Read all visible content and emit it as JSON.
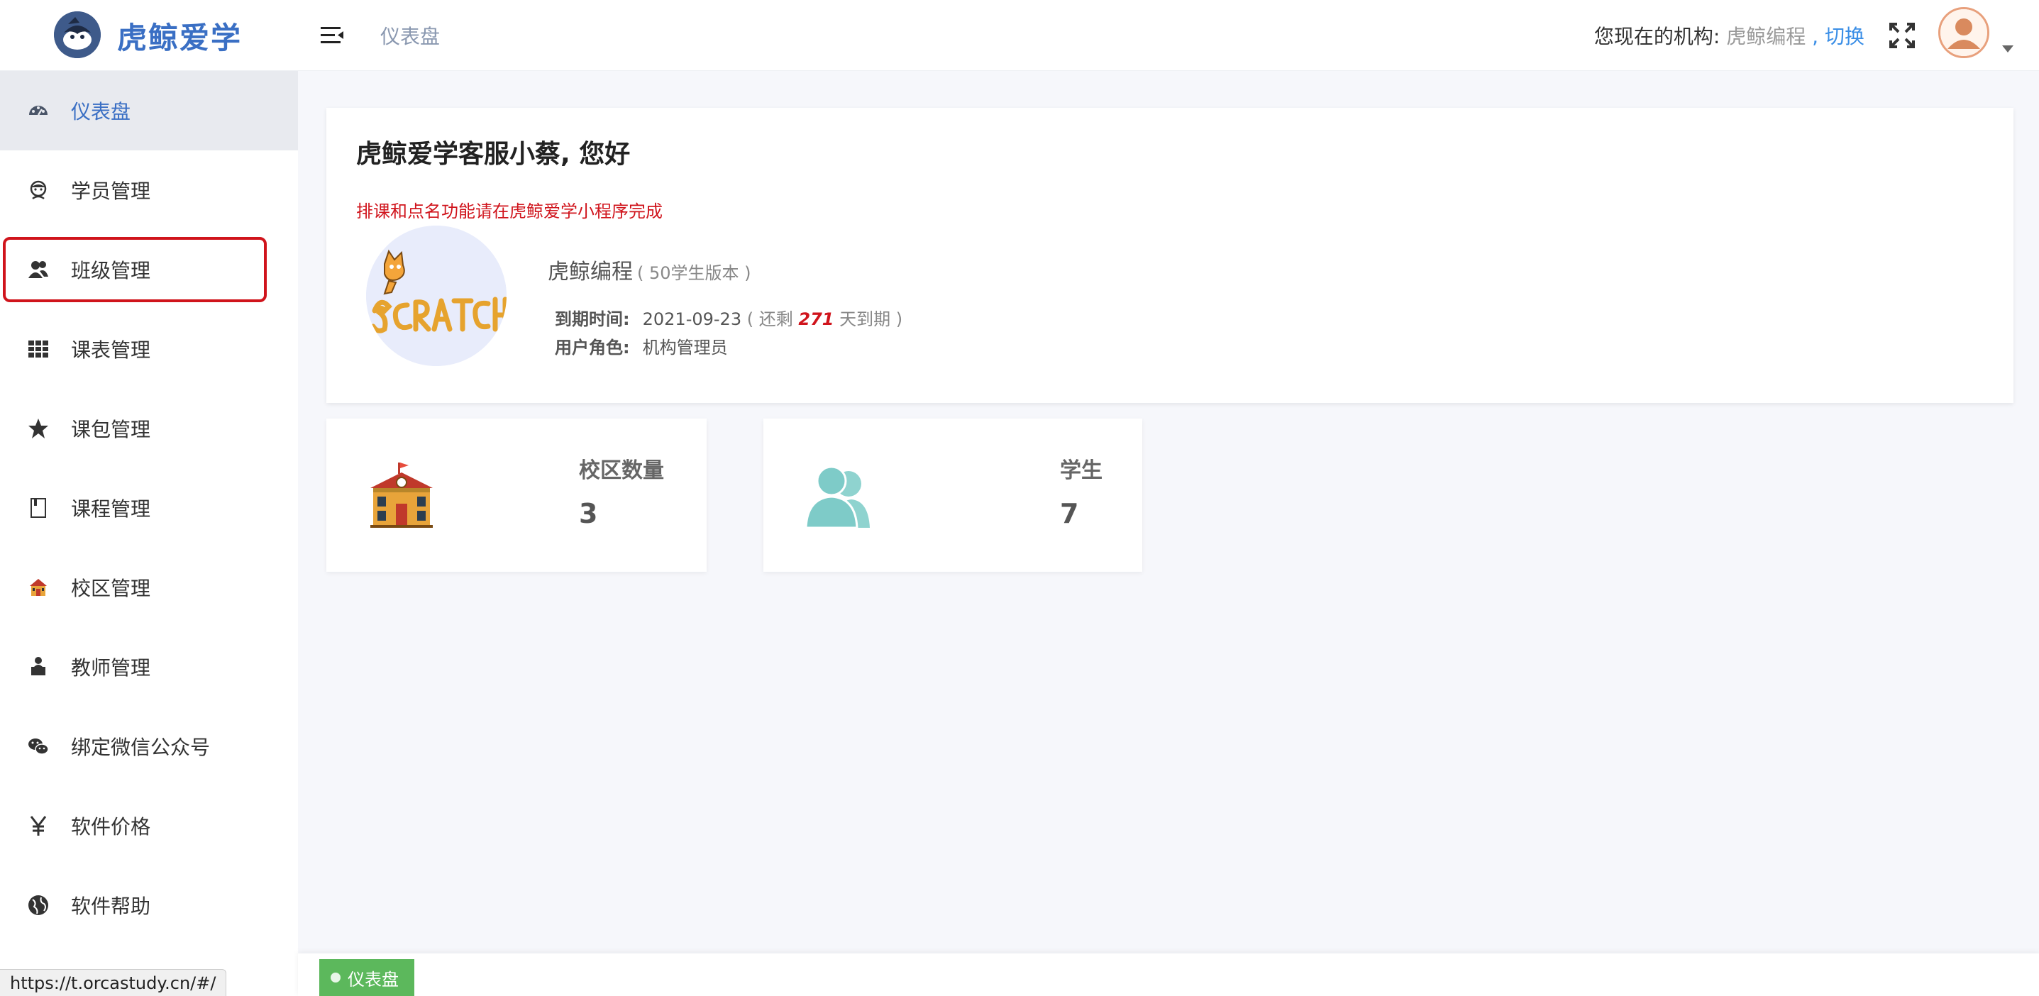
{
  "header": {
    "brand": "虎鲸爱学",
    "breadcrumb": "仪表盘",
    "org_label": "您现在的机构: ",
    "org_name": "虎鲸编程",
    "org_separator": " , ",
    "org_switch": "切换"
  },
  "sidebar": {
    "items": [
      {
        "label": "仪表盘",
        "icon": "dashboard-icon"
      },
      {
        "label": "学员管理",
        "icon": "student-icon"
      },
      {
        "label": "班级管理",
        "icon": "users-icon"
      },
      {
        "label": "课表管理",
        "icon": "grid-icon"
      },
      {
        "label": "课包管理",
        "icon": "star-icon"
      },
      {
        "label": "课程管理",
        "icon": "book-icon"
      },
      {
        "label": "校区管理",
        "icon": "school-icon"
      },
      {
        "label": "教师管理",
        "icon": "teacher-icon"
      },
      {
        "label": "绑定微信公众号",
        "icon": "wechat-icon"
      },
      {
        "label": "软件价格",
        "icon": "yen-icon"
      },
      {
        "label": "软件帮助",
        "icon": "globe-icon"
      }
    ]
  },
  "welcome": {
    "title": "虎鲸爱学客服小蔡, 您好",
    "notice": "排课和点名功能请在虎鲸爱学小程序完成",
    "org_name": "虎鲸编程",
    "version": "( 50学生版本 )",
    "expire_label": "到期时间:",
    "expire_date": "2021-09-23",
    "expire_prefix": "( 还剩",
    "expire_days": "271",
    "expire_suffix": "天到期 )",
    "role_label": "用户角色:",
    "role_value": "机构管理员"
  },
  "stats": [
    {
      "label": "校区数量",
      "value": "3",
      "icon": "school-building-icon"
    },
    {
      "label": "学生",
      "value": "7",
      "icon": "students-icon"
    }
  ],
  "tabs": {
    "active": "仪表盘"
  },
  "status_bar": {
    "url": "https://t.orcastudy.cn/#/"
  },
  "colors": {
    "brand": "#3a6fc4",
    "notice": "#d0141c",
    "tab_active": "#5cb85c",
    "highlight": "#d0141c",
    "student_icon": "#7ecbc8"
  }
}
